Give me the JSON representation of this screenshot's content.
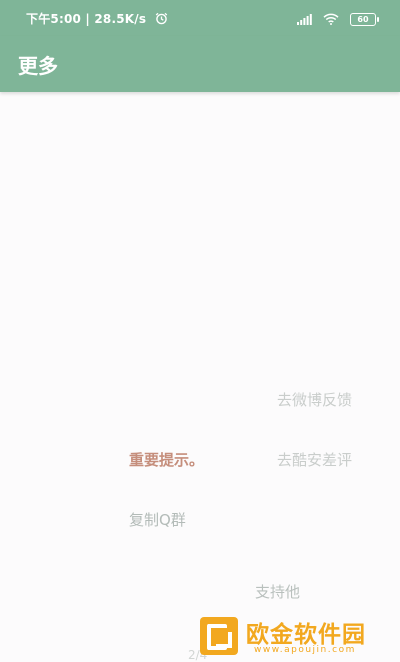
{
  "status_bar": {
    "time_speed": "下午5:00 | 28.5K/s",
    "battery": "60",
    "icons": [
      "alarm-icon",
      "signal-icon",
      "wifi-icon",
      "battery-icon"
    ]
  },
  "app_bar": {
    "title": "更多"
  },
  "menu": {
    "weibo_feedback": "去微博反馈",
    "notice": "重要提示。",
    "coolapk_review": "去酷安差评",
    "copy_qq_group": "复制Q群",
    "support": "支持他"
  },
  "page_indicator": "2/4",
  "watermark": {
    "brand": "欧金软件园",
    "url": "www.apoujin.com"
  },
  "colors": {
    "primary": "#7fb598",
    "notice": "#c58e7c",
    "watermark": "#f2a81f"
  }
}
